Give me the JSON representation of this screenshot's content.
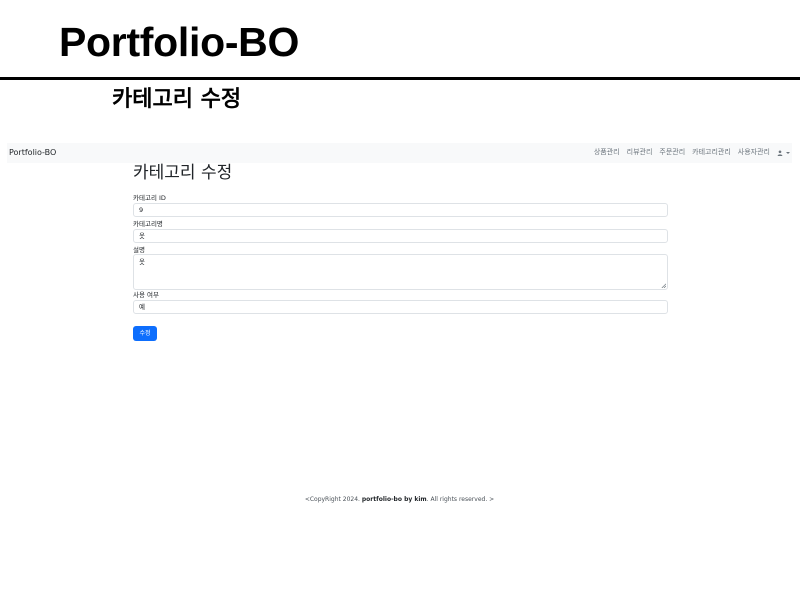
{
  "slide": {
    "title": "Portfolio-BO",
    "subtitle": "카테고리 수정"
  },
  "navbar": {
    "brand": "Portfolio-BO",
    "links": [
      "상품관리",
      "리뷰관리",
      "주문관리",
      "카테고리관리",
      "사용자관리"
    ],
    "user_icon": "user-icon"
  },
  "page": {
    "heading": "카테고리 수정"
  },
  "form": {
    "category_id": {
      "label": "카테고리 ID",
      "value": "9"
    },
    "category_name": {
      "label": "카테고리명",
      "value": "옷"
    },
    "description": {
      "label": "설명",
      "value": "옷"
    },
    "use_yn": {
      "label": "사용 여부",
      "value": "예"
    },
    "submit_label": "수정"
  },
  "footer": {
    "prefix": "<CopyRight 2024. ",
    "brand": "portfolio-bo by kim",
    "suffix": ". All rights reserved. >"
  },
  "colors": {
    "primary": "#0d6efd",
    "navbar_bg": "#f8f9fa",
    "border": "#dee2e6"
  }
}
